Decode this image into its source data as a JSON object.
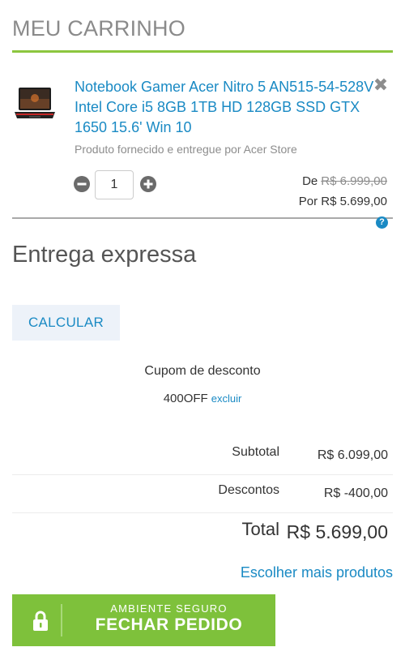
{
  "cart": {
    "title": "MEU CARRINHO"
  },
  "item": {
    "name": "Notebook Gamer Acer Nitro 5 AN515-54-528V Intel Core i5 8GB 1TB HD 128GB SSD GTX 1650 15.6' Win 10",
    "seller": "Produto fornecido e entregue por Acer Store",
    "quantity": "1",
    "price_old_prefix": "De",
    "price_old": "R$ 6.999,00",
    "price_new": "Por R$ 5.699,00",
    "remove_icon": "close-icon"
  },
  "delivery": {
    "title": "Entrega expressa",
    "calculate_label": "CALCULAR"
  },
  "coupon": {
    "label": "Cupom de desconto",
    "code": "400OFF",
    "remove_label": "excluir"
  },
  "summary": {
    "subtotal_label": "Subtotal",
    "subtotal_value": "R$ 6.099,00",
    "discount_label": "Descontos",
    "discount_value": "R$ -400,00",
    "total_label": "Total",
    "total_value": "R$ 5.699,00"
  },
  "links": {
    "more_products": "Escolher mais produtos"
  },
  "checkout": {
    "secure_label": "AMBIENTE SEGURO",
    "button_label": "FECHAR PEDIDO"
  },
  "colors": {
    "accent": "#1a8ac4",
    "brand_green": "#7ec13b",
    "title_rule": "#8cc63f"
  }
}
